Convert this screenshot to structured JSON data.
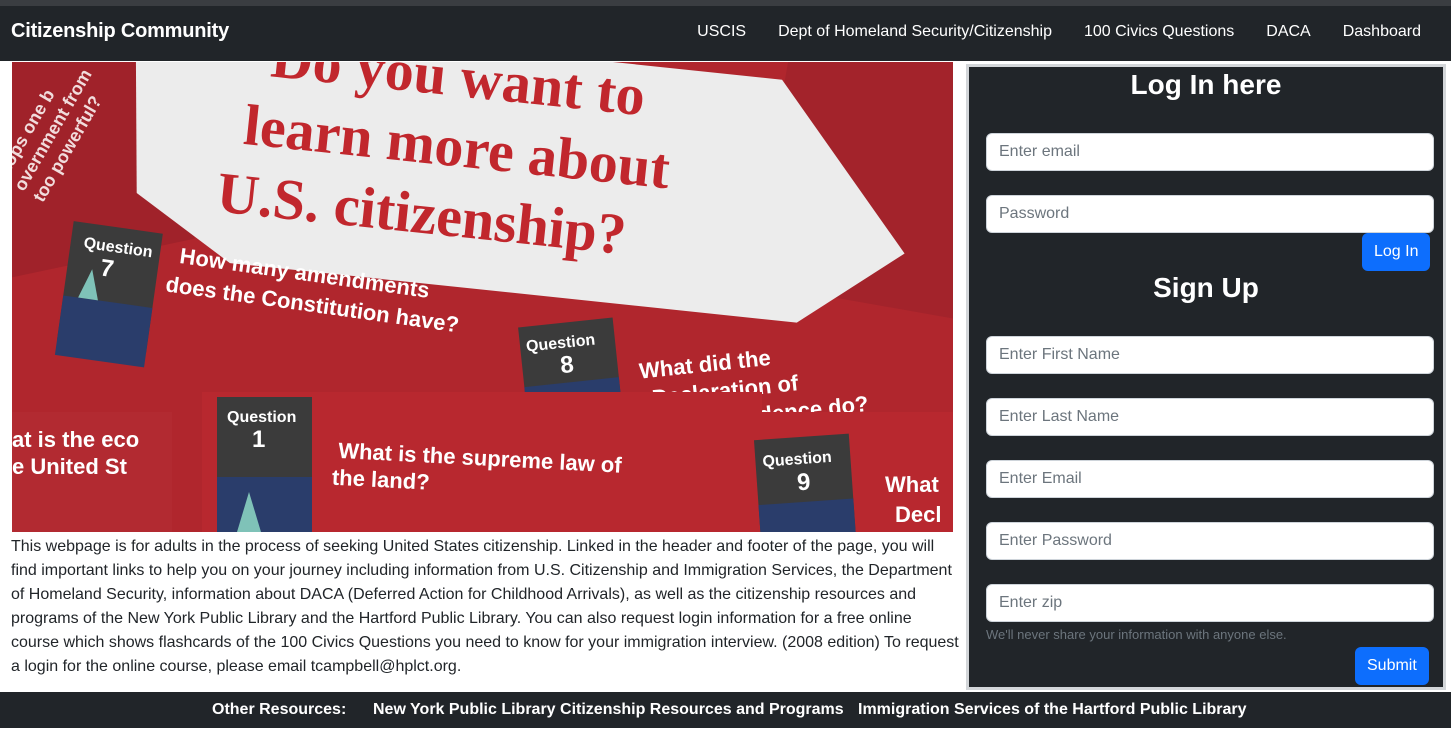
{
  "navbar": {
    "brand": "Citizenship Community",
    "links": [
      "USCIS",
      "Dept of Homeland Security/Citizenship",
      "100 Civics Questions",
      "DACA",
      "Dashboard"
    ]
  },
  "hero": {
    "headline_lines": [
      "Do you want to",
      "learn more about",
      "U.S. citizenship?"
    ],
    "cards": [
      {
        "label": "Question",
        "number": "7",
        "text_lines": [
          "How many amendments",
          "does the Constitution have?"
        ]
      },
      {
        "label": "Question",
        "number": "8",
        "text_lines": [
          "What did the",
          "Declaration of",
          "Independence do?"
        ]
      },
      {
        "label": "Question",
        "number": "1",
        "text_lines": [
          "What is the supreme law of",
          "the land?"
        ]
      },
      {
        "label": "Question",
        "number": "9",
        "text_lines": [
          "What",
          "Decl"
        ]
      }
    ],
    "side_text_lines": [
      "at is the eco",
      "e United St"
    ],
    "corner_text_lines": [
      "stops one b",
      "overnment from",
      "too powerful?"
    ]
  },
  "description": "This webpage is for adults in the process of seeking United States citizenship. Linked in the header and footer of the page, you will find important links to help you on your journey including information from U.S. Citizenship and Immigration Services, the Department of Homeland Security, information about DACA (Deferred Action for Childhood Arrivals), as well as the citizenship resources and programs of the New York Public Library and the Hartford Public Library. You can also request login information for a free online course which shows flashcards of the 100 Civics Questions you need to know for your immigration interview. (2008 edition) To request a login for the online course, please email tcampbell@hplct.org.",
  "login": {
    "heading": "Log In here",
    "email_placeholder": "Enter email",
    "password_placeholder": "Password",
    "button": "Log In"
  },
  "signup": {
    "heading": "Sign Up",
    "first_name_placeholder": "Enter First Name",
    "last_name_placeholder": "Enter Last Name",
    "email_placeholder": "Enter Email",
    "password_placeholder": "Enter Password",
    "zip_placeholder": "Enter zip",
    "help_text": "We'll never share your information with anyone else.",
    "button": "Submit"
  },
  "footer": {
    "label": "Other Resources:",
    "links": [
      "New York Public Library Citizenship Resources and Programs",
      "Immigration Services of the Hartford Public Library"
    ]
  },
  "colors": {
    "navbar_bg": "#212529",
    "primary_button": "#0d6efd",
    "hero_red": "#b0262d",
    "card_red": "#c0323a"
  }
}
